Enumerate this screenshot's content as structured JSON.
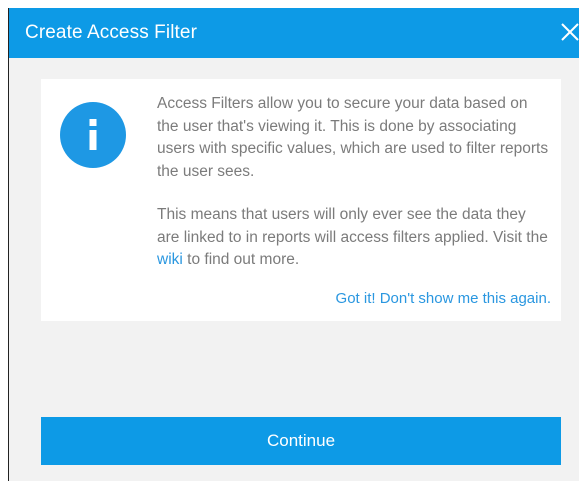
{
  "dialog": {
    "title": "Create Access Filter",
    "close_icon": "close-icon",
    "info_icon": "info-icon",
    "paragraph1": "Access Filters allow you to secure your data based on the user that's viewing it. This is done by associating users with specific values, which are used to filter reports the user sees.",
    "paragraph2_before": "This means that users will only ever see the data they are linked to in reports will access filters applied. Visit the ",
    "paragraph2_link": "wiki",
    "paragraph2_after": " to find out more.",
    "dismiss_link": "Got it! Don't show me this again.",
    "continue_label": "Continue"
  },
  "colors": {
    "accent": "#0d9ae6",
    "link": "#2a97e0",
    "body_text": "#7b7b7b",
    "background": "#f2f2f2",
    "panel": "#ffffff"
  }
}
